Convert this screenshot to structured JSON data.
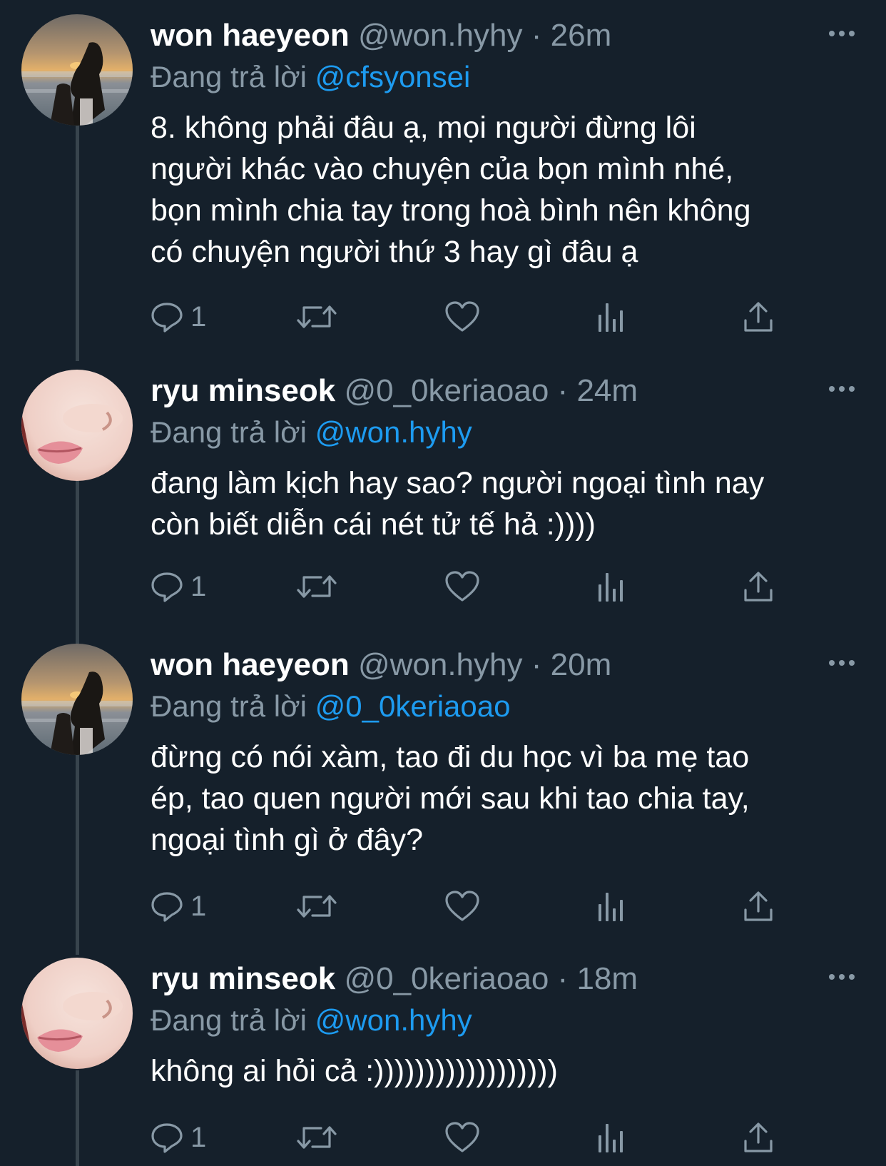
{
  "tweets": [
    {
      "name": "won haeyeon",
      "handle": "@won.hyhy",
      "dot": "·",
      "time": "26m",
      "reply_prefix": "Đang trả lời",
      "reply_to": "@cfsyonsei",
      "text": "8. không phải đâu ạ, mọi người đừng lôi\nngười khác vào chuyện của bọn mình nhé,\nbọn mình chia tay trong hoà bình nên không\ncó chuyện người thứ 3 hay gì đâu ạ",
      "reply_count": "1",
      "avatar": "sunset-beach-avatar"
    },
    {
      "name": "ryu minseok",
      "handle": "@0_0keriaoao",
      "dot": "·",
      "time": "24m",
      "reply_prefix": "Đang trả lời",
      "reply_to": "@won.hyhy",
      "text": "đang làm kịch hay sao? người ngoại tình nay\ncòn biết diễn cái nét tử tế hả :))))",
      "reply_count": "1",
      "avatar": "face-closeup-avatar"
    },
    {
      "name": "won haeyeon",
      "handle": "@won.hyhy",
      "dot": "·",
      "time": "20m",
      "reply_prefix": "Đang trả lời",
      "reply_to": "@0_0keriaoao",
      "text": "đừng có nói xàm, tao đi du học vì ba mẹ tao\nép, tao quen người mới sau khi tao chia tay,\nngoại tình gì ở đây?",
      "reply_count": "1",
      "avatar": "sunset-beach-avatar"
    },
    {
      "name": "ryu minseok",
      "handle": "@0_0keriaoao",
      "dot": "·",
      "time": "18m",
      "reply_prefix": "Đang trả lời",
      "reply_to": "@won.hyhy",
      "text": "không ai hỏi cả :))))))))))))))))))",
      "reply_count": "1",
      "avatar": "face-closeup-avatar"
    }
  ],
  "colors": {
    "background": "#15202b",
    "secondary_text": "#8899a6",
    "mention": "#1d9bf0",
    "thread_line": "#38444d"
  }
}
